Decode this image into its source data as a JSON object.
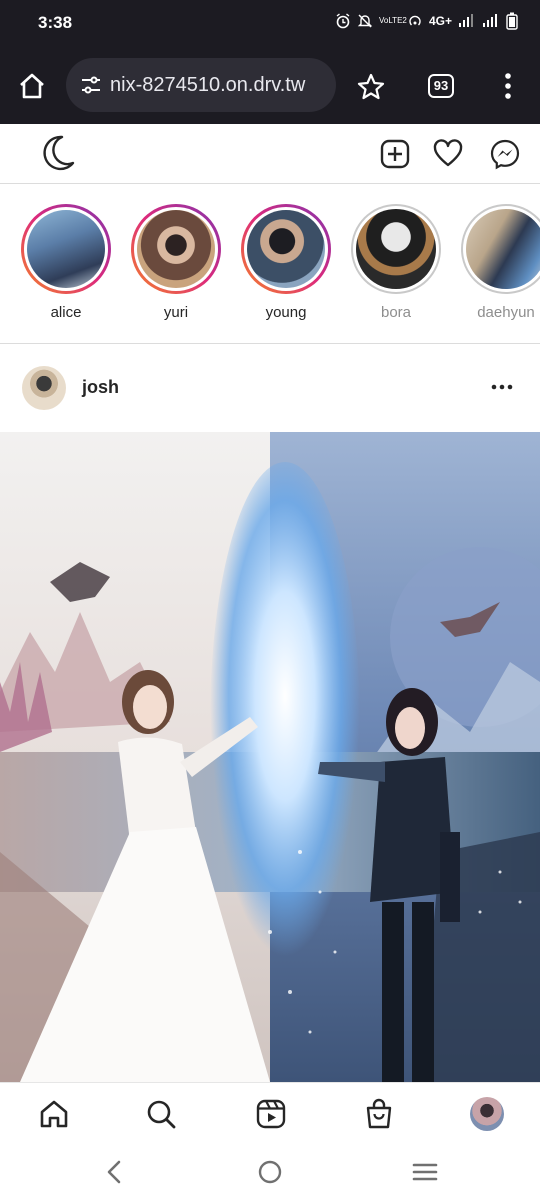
{
  "status_bar": {
    "time": "3:38",
    "network": "4G+",
    "volte": "VoLTE2"
  },
  "browser": {
    "url": "nix-8274510.on.drv.tw",
    "tab_count": "93"
  },
  "stories": [
    {
      "name": "alice",
      "seen": false
    },
    {
      "name": "yuri",
      "seen": false
    },
    {
      "name": "young",
      "seen": false
    },
    {
      "name": "bora",
      "seen": true
    },
    {
      "name": "daehyun",
      "seen": true
    }
  ],
  "post": {
    "username": "josh"
  },
  "icons": {
    "theme": "moon-icon",
    "create": "add-square-icon",
    "activity": "heart-icon",
    "messages": "messenger-icon",
    "bottom_nav": [
      "home-icon",
      "search-icon",
      "reels-icon",
      "shop-bag-icon",
      "profile-avatar"
    ]
  },
  "colors": {
    "story_ring_gradient": [
      "#f58529",
      "#dd2a7b",
      "#8134af"
    ],
    "seen_ring": "#c9c9c9",
    "browser_bar": "#1c1b22"
  }
}
